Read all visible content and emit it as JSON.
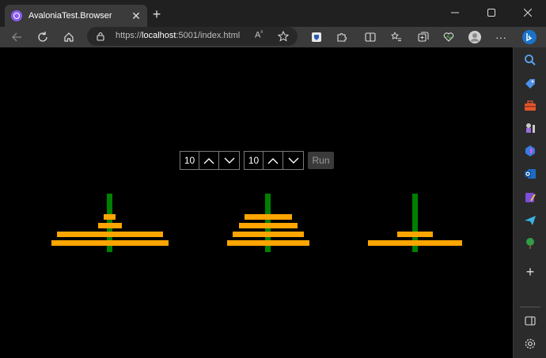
{
  "browser": {
    "tab_title": "AvaloniaTest.Browser",
    "url_prefix": "https://",
    "url_host": "localhost",
    "url_rest": ":5001/index.html"
  },
  "app": {
    "disks_count": "10",
    "second_value": "10",
    "run_label": "Run"
  },
  "colors": {
    "peg": "#008000",
    "disk": "#ffa500",
    "background": "#000000"
  }
}
